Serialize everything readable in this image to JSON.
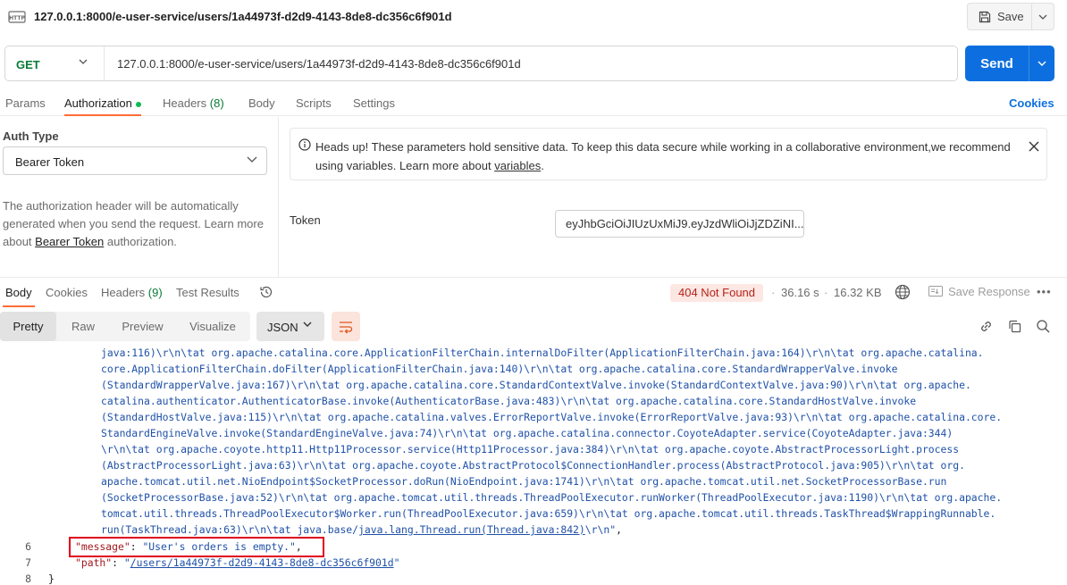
{
  "title_bar": {
    "url_title": "127.0.0.1:8000/e-user-service/users/1a44973f-d2d9-4143-8de8-dc356c6f901d",
    "http_icon_label": "HTTP",
    "save_label": "Save"
  },
  "request": {
    "method": "GET",
    "url": "127.0.0.1:8000/e-user-service/users/1a44973f-d2d9-4143-8de8-dc356c6f901d",
    "send_label": "Send"
  },
  "request_tabs": {
    "params": "Params",
    "authorization": "Authorization",
    "headers": "Headers",
    "headers_count": "(8)",
    "body": "Body",
    "scripts": "Scripts",
    "settings": "Settings",
    "cookies": "Cookies"
  },
  "auth": {
    "type_label": "Auth Type",
    "type_value": "Bearer Token",
    "help_line1": "The authorization header will be automatically",
    "help_line2": "generated when you send the request. Learn more",
    "help_line3_prefix": "about ",
    "help_link": "Bearer Token",
    "help_line3_suffix": " authorization.",
    "banner_line1": "Heads up! These parameters hold sensitive data. To keep this data secure while working in a collaborative environment,we recommend",
    "banner_line2_prefix": "using variables. Learn more about ",
    "banner_link": "variables",
    "banner_line2_suffix": ".",
    "token_label": "Token",
    "token_value": "eyJhbGciOiJIUzUxMiJ9.eyJzdWliOiJjZDZiNI..."
  },
  "response": {
    "tabs": {
      "body": "Body",
      "cookies": "Cookies",
      "headers": "Headers",
      "headers_count": "(9)",
      "test_results": "Test Results"
    },
    "status": "404 Not Found",
    "time": "36.16 s",
    "size": "16.32 KB",
    "save_response": "Save Response",
    "format": {
      "pretty": "Pretty",
      "raw": "Raw",
      "preview": "Preview",
      "visualize": "Visualize",
      "language": "JSON"
    },
    "code": {
      "trace_lines": [
        "java:116)\\r\\n\\tat org.apache.catalina.core.ApplicationFilterChain.internalDoFilter(ApplicationFilterChain.java:164)\\r\\n\\tat org.apache.catalina.",
        "core.ApplicationFilterChain.doFilter(ApplicationFilterChain.java:140)\\r\\n\\tat org.apache.catalina.core.StandardWrapperValve.invoke",
        "(StandardWrapperValve.java:167)\\r\\n\\tat org.apache.catalina.core.StandardContextValve.invoke(StandardContextValve.java:90)\\r\\n\\tat org.apache.",
        "catalina.authenticator.AuthenticatorBase.invoke(AuthenticatorBase.java:483)\\r\\n\\tat org.apache.catalina.core.StandardHostValve.invoke",
        "(StandardHostValve.java:115)\\r\\n\\tat org.apache.catalina.valves.ErrorReportValve.invoke(ErrorReportValve.java:93)\\r\\n\\tat org.apache.catalina.core.",
        "StandardEngineValve.invoke(StandardEngineValve.java:74)\\r\\n\\tat org.apache.catalina.connector.CoyoteAdapter.service(CoyoteAdapter.java:344)",
        "\\r\\n\\tat org.apache.coyote.http11.Http11Processor.service(Http11Processor.java:384)\\r\\n\\tat org.apache.coyote.AbstractProcessorLight.process",
        "(AbstractProcessorLight.java:63)\\r\\n\\tat org.apache.coyote.AbstractProtocol$ConnectionHandler.process(AbstractProtocol.java:905)\\r\\n\\tat org.",
        "apache.tomcat.util.net.NioEndpoint$SocketProcessor.doRun(NioEndpoint.java:1741)\\r\\n\\tat org.apache.tomcat.util.net.SocketProcessorBase.run",
        "(SocketProcessorBase.java:52)\\r\\n\\tat org.apache.tomcat.util.threads.ThreadPoolExecutor.runWorker(ThreadPoolExecutor.java:1190)\\r\\n\\tat org.apache.",
        "tomcat.util.threads.ThreadPoolExecutor$Worker.run(ThreadPoolExecutor.java:659)\\r\\n\\tat org.apache.tomcat.util.threads.TaskThread$WrappingRunnable."
      ],
      "trace_last_a": "run(TaskThread.java:63)\\r\\n\\tat java.base/",
      "trace_last_link": "java.lang.Thread.run(Thread.java:842)",
      "trace_last_b": "\\r\\n\"",
      "trace_last_comma": ",",
      "line6_num": "6",
      "message_key": "\"message\"",
      "message_value": "\"User's orders is empty.\"",
      "line7_num": "7",
      "path_key": "\"path\"",
      "path_quote_open": "\"",
      "path_value": "/users/1a44973f-d2d9-4143-8de8-dc356c6f901d",
      "path_quote_close": "\"",
      "line8_num": "8",
      "closing_brace": "}"
    }
  },
  "colors": {
    "send_blue": "#0d6fdf",
    "active_tab_orange": "#ff6c37",
    "status_red": "#b42318",
    "highlight_red": "#e0001b",
    "method_green": "#0a7a37"
  }
}
